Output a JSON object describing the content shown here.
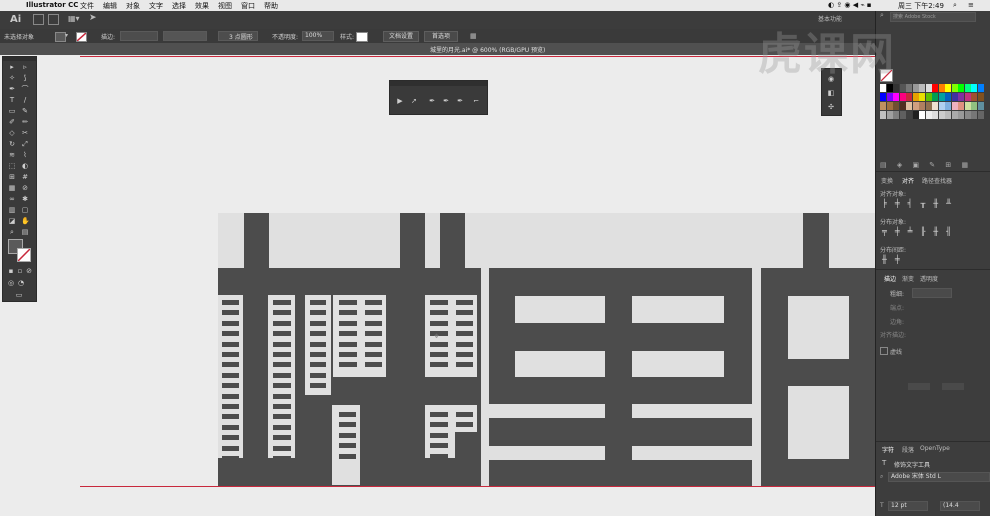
{
  "menubar": {
    "apple": "",
    "app_name": "Illustrator CC",
    "items": [
      "文件",
      "编辑",
      "对象",
      "文字",
      "选择",
      "效果",
      "视图",
      "窗口",
      "帮助"
    ],
    "clock": "周三 下午2:49"
  },
  "appbar": {
    "logo": "Ai",
    "workspace": "基本功能"
  },
  "control_bar": {
    "selection_state": "未选择对象",
    "stroke_label": "描边:",
    "brush_value": "3 点圆形",
    "opacity_label": "不透明度:",
    "opacity_value": "100%",
    "style_label": "样式:",
    "doc_setup_button": "文档设置",
    "preferences_button": "首选项"
  },
  "document": {
    "tab_title": "城里的月光.ai* @ 600% (RGB/GPU 预览)"
  },
  "right_panel": {
    "search_placeholder": "搜索 Adobe Stock",
    "align_tabs": [
      "变换",
      "对齐",
      "路径查找器"
    ],
    "align_objects_label": "对齐对象:",
    "distribute_objects_label": "分布对象:",
    "distribute_spacing_label": "分布间距:",
    "stroke_tabs": [
      "描边",
      "渐变",
      "透明度"
    ],
    "weight_label": "粗细:",
    "end_label": "端点:",
    "corner_label": "边角:",
    "align_stroke_label": "对齐描边:",
    "dashed_label": "虚线",
    "char_tabs": [
      "字符",
      "段落",
      "OpenType"
    ],
    "touch_type_label": "修饰文字工具",
    "font_value": "Adobe 宋体 Std L",
    "font_size_value": "12 pt",
    "leading_value": "(14.4"
  },
  "colors": {
    "accent_guide": "#c8283c",
    "artwork_dark": "#4c4c4c",
    "artwork_light": "#e0e0e0"
  },
  "watermark": "虎课网"
}
